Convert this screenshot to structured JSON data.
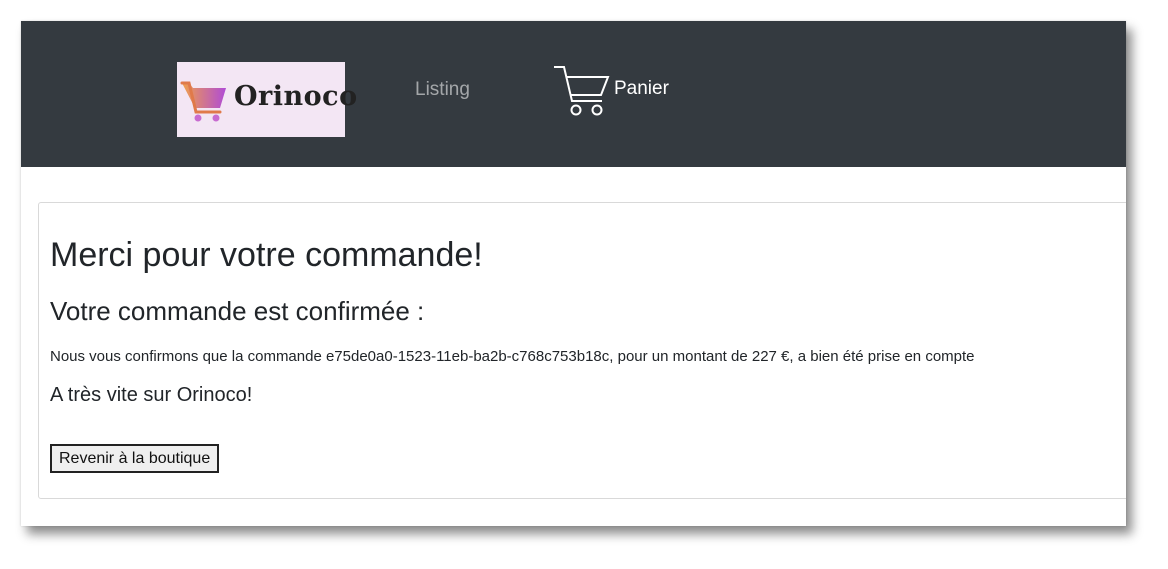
{
  "header": {
    "logo_text": "Orinoco",
    "logo_icon": "shopping-cart-icon",
    "nav_listing": "Listing",
    "nav_cart_label": "Panier",
    "nav_cart_icon": "cart-outline-icon",
    "colors": {
      "navbar_bg": "#343a40",
      "logo_bg": "#f3e6f4",
      "cart_gradient_start": "#f0a04b",
      "cart_gradient_end": "#b04bd6"
    }
  },
  "confirmation": {
    "title": "Merci pour votre commande!",
    "subtitle": "Votre commande est confirmée :",
    "message": "Nous vous confirmons que la commande e75de0a0-1523-11eb-ba2b-c768c753b18c, pour un montant de 227 €, a bien été prise en compte",
    "farewell": "A très vite sur Orinoco!",
    "back_button": "Revenir à la boutique"
  }
}
